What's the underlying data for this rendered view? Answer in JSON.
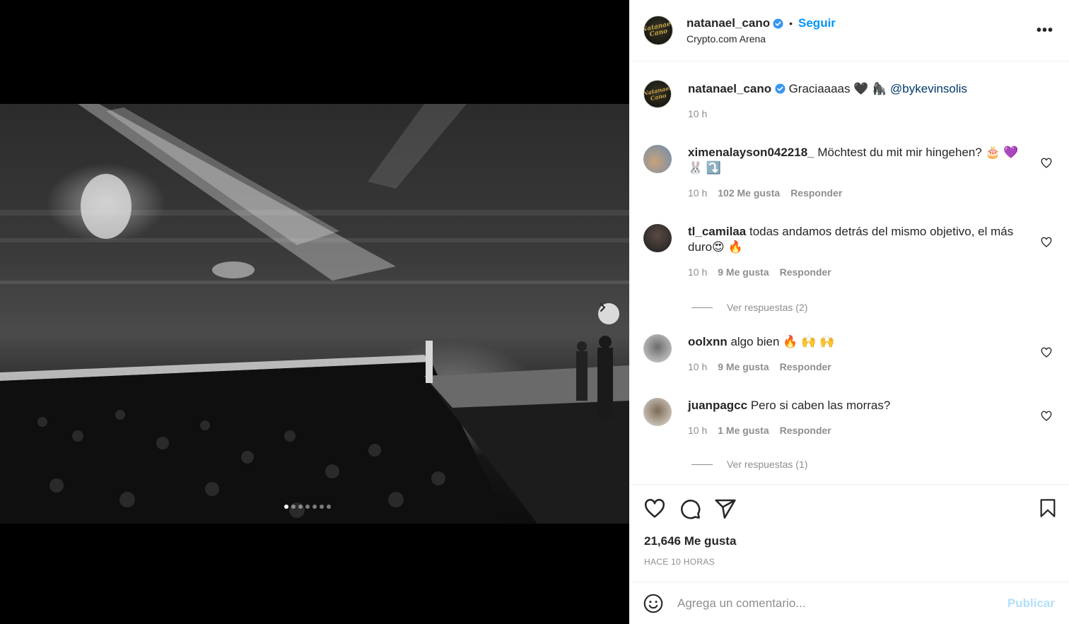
{
  "post": {
    "author": "natanael_cano",
    "location": "Crypto.com Arena",
    "follow_label": "Seguir",
    "separator": "•",
    "more_label": "•••",
    "avatar_text": "Natanael Cano",
    "caption": {
      "text": "Graciaaaas 🖤 🦍",
      "mention": "@bykevinsolis",
      "time": "10 h"
    },
    "carousel": {
      "slides": 7,
      "active": 1
    }
  },
  "comments": [
    {
      "user": "ximenalayson042218_",
      "text": "Möchtest du mit mir hingehen? 🎂 💜 🐰 ⤵️",
      "time": "10 h",
      "likes": "102 Me gusta",
      "reply": "Responder"
    },
    {
      "user": "tl_camilaa",
      "text": "todas andamos detrás del mismo objetivo, el más duro😍 🔥",
      "time": "10 h",
      "likes": "9 Me gusta",
      "reply": "Responder",
      "replies_label": "Ver respuestas (2)"
    },
    {
      "user": "oolxnn",
      "text": "algo bien 🔥 🙌 🙌",
      "time": "10 h",
      "likes": "9 Me gusta",
      "reply": "Responder"
    },
    {
      "user": "juanpagcc",
      "text": "Pero si caben las morras?",
      "time": "10 h",
      "likes": "1 Me gusta",
      "reply": "Responder",
      "replies_label": "Ver respuestas (1)"
    }
  ],
  "stats": {
    "likes": "21,646 Me gusta",
    "time_ago": "HACE 10 HORAS"
  },
  "comment_box": {
    "placeholder": "Agrega un comentario...",
    "publish_label": "Publicar"
  },
  "colors": {
    "accent": "#0095f6",
    "verified": "#3897f0",
    "muted": "#8e8e8e",
    "publish_disabled": "#b2dffc"
  },
  "icons": [
    "chevron-right-icon",
    "verified-icon",
    "heart-icon",
    "comment-icon",
    "share-icon",
    "bookmark-icon",
    "emoji-icon",
    "more-icon"
  ]
}
